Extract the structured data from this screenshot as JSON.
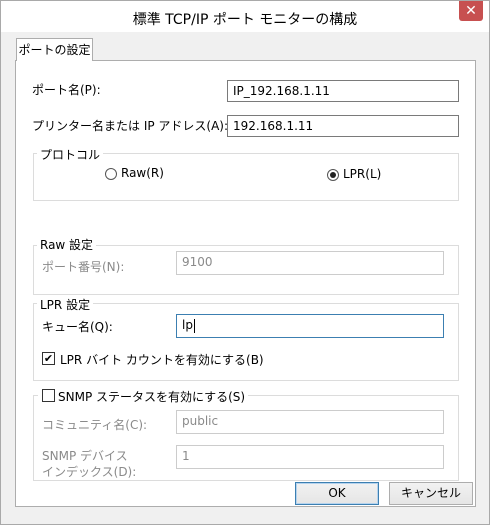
{
  "window": {
    "title": "標準 TCP/IP ポート モニターの構成",
    "close_glyph": "✕"
  },
  "tab": {
    "label": "ポートの設定"
  },
  "port_name": {
    "label": "ポート名(P):",
    "value": "IP_192.168.1.11"
  },
  "printer_address": {
    "label": "プリンター名または IP アドレス(A):",
    "value": "192.168.1.11"
  },
  "protocol": {
    "group_label": "プロトコル",
    "options": [
      {
        "label": "Raw(R)",
        "selected": false
      },
      {
        "label": "LPR(L)",
        "selected": true
      }
    ]
  },
  "raw_settings": {
    "group_label": "Raw 設定",
    "port_number_label": "ポート番号(N):",
    "port_number_value": "9100"
  },
  "lpr_settings": {
    "group_label": "LPR 設定",
    "queue_name_label": "キュー名(Q):",
    "queue_name_value": "lp",
    "byte_count_label": "LPR バイト カウントを有効にする(B)",
    "byte_count_checked": true
  },
  "snmp": {
    "group_label": "SNMP ステータスを有効にする(S)",
    "enabled": false,
    "community_label": "コミュニティ名(C):",
    "community_value": "public",
    "device_index_label_line1": "SNMP デバイス",
    "device_index_label_line2": "インデックス(D):",
    "device_index_value": "1"
  },
  "buttons": {
    "ok": "OK",
    "cancel": "キャンセル"
  }
}
